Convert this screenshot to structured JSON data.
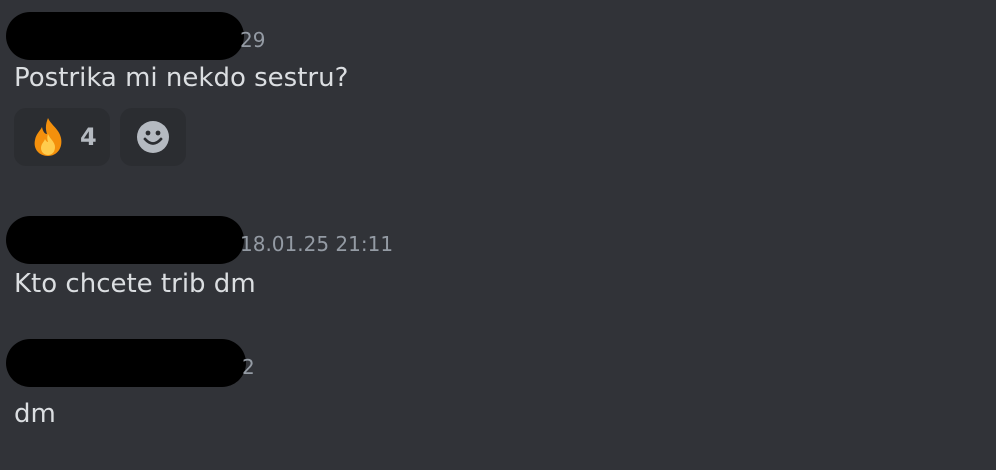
{
  "messages": [
    {
      "timestamp": "29",
      "text": "Postrika mi nekdo sestru?",
      "reactions": [
        {
          "icon": "fire-icon",
          "count": "4"
        }
      ],
      "add_reaction_icon": "smiley-icon"
    },
    {
      "timestamp": "18.01.25 21:11",
      "text": "Kto chcete trib dm"
    },
    {
      "timestamp": "2",
      "text": "dm"
    }
  ],
  "colors": {
    "background": "#313338",
    "text": "#dbdee1",
    "muted": "#949ba4",
    "reaction_bg": "#2b2d31",
    "redaction": "#000000"
  }
}
